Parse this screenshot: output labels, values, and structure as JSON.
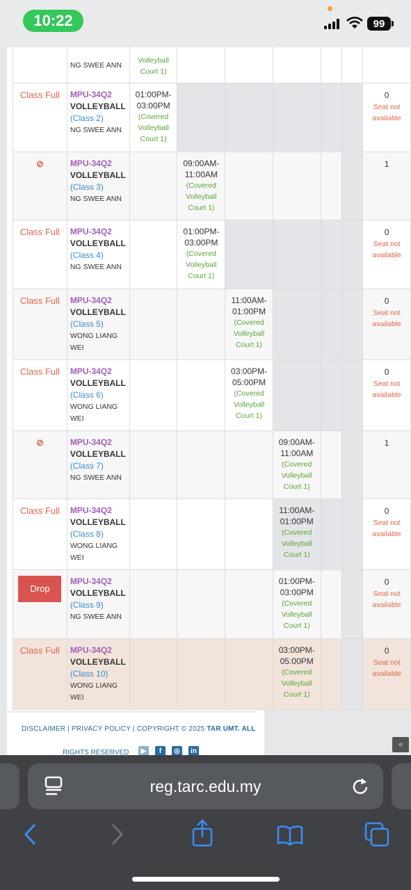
{
  "status_bar": {
    "time": "10:22",
    "battery": "99"
  },
  "table": {
    "top_partial": {
      "lecturer": "NG SWEE ANN",
      "venue": "Volleyball Court 1)"
    },
    "rows": [
      {
        "status": "Class Full",
        "code": "MPU-34Q2",
        "title": "VOLLEYBALL",
        "class": "(Class 2)",
        "lecturer": "NG SWEE ANN",
        "time": "01:00PM-03:00PM",
        "venue": "(Covered Volleyball Court 1)",
        "seats": "0",
        "seat_msg": "Seat not available"
      },
      {
        "status": "⊘",
        "code": "MPU-34Q2",
        "title": "VOLLEYBALL",
        "class": "(Class 3)",
        "lecturer": "NG SWEE ANN",
        "time": "09:00AM-11:00AM",
        "venue": "(Covered Volleyball Court 1)",
        "seats": "1",
        "seat_msg": ""
      },
      {
        "status": "Class Full",
        "code": "MPU-34Q2",
        "title": "VOLLEYBALL",
        "class": "(Class 4)",
        "lecturer": "NG SWEE ANN",
        "time": "01:00PM-03:00PM",
        "venue": "(Covered Volleyball Court 1)",
        "seats": "0",
        "seat_msg": "Seat not available"
      },
      {
        "status": "Class Full",
        "code": "MPU-34Q2",
        "title": "VOLLEYBALL",
        "class": "(Class 5)",
        "lecturer": "WONG LIANG WEI",
        "time": "11:00AM-01:00PM",
        "venue": "(Covered Volleyball Court 1)",
        "seats": "0",
        "seat_msg": "Seat not available"
      },
      {
        "status": "Class Full",
        "code": "MPU-34Q2",
        "title": "VOLLEYBALL",
        "class": "(Class 6)",
        "lecturer": "WONG LIANG WEI",
        "time": "03:00PM-05:00PM",
        "venue": "(Covered Volleyball Court 1)",
        "seats": "0",
        "seat_msg": "Seat not available"
      },
      {
        "status": "⊘",
        "code": "MPU-34Q2",
        "title": "VOLLEYBALL",
        "class": "(Class 7)",
        "lecturer": "NG SWEE ANN",
        "time": "09:00AM-11:00AM",
        "venue": "(Covered Volleyball Court 1)",
        "seats": "1",
        "seat_msg": ""
      },
      {
        "status": "Class Full",
        "code": "MPU-34Q2",
        "title": "VOLLEYBALL",
        "class": "(Class 8)",
        "lecturer": "WONG LIANG WEI",
        "time": "11:00AM-01:00PM",
        "venue": "(Covered Volleyball Court 1)",
        "seats": "0",
        "seat_msg": "Seat not available"
      },
      {
        "status": "Drop",
        "code": "MPU-34Q2",
        "title": "VOLLEYBALL",
        "class": "(Class 9)",
        "lecturer": "NG SWEE ANN",
        "time": "01:00PM-03:00PM",
        "venue": "(Covered Volleyball Court 1)",
        "seats": "0",
        "seat_msg": "Seat not available"
      },
      {
        "status": "Class Full",
        "code": "MPU-34Q2",
        "title": "VOLLEYBALL",
        "class": "(Class 10)",
        "lecturer": "WONG LIANG WEI",
        "time": "03:00PM-05:00PM",
        "venue": "(Covered Volleyball Court 1)",
        "seats": "0",
        "seat_msg": "Seat not available"
      }
    ]
  },
  "footer": {
    "links": [
      "DISCLAIMER",
      "PRIVACY POLICY"
    ],
    "copyright": "COPYRIGHT © 2025",
    "org": "TAR UMT. ALL",
    "rights": "RIGHTS RESERVED",
    "social_icons": [
      "youtube-icon",
      "facebook-icon",
      "instagram-icon",
      "linkedin-icon"
    ]
  },
  "browser": {
    "url": "reg.tarc.edu.my"
  },
  "colors": {
    "full": "#e0664a",
    "code": "#a35fb5",
    "class": "#3c8dc8",
    "venue": "#5aa33a",
    "drop": "#d9534f",
    "highlight_row": "#f2e4db"
  }
}
